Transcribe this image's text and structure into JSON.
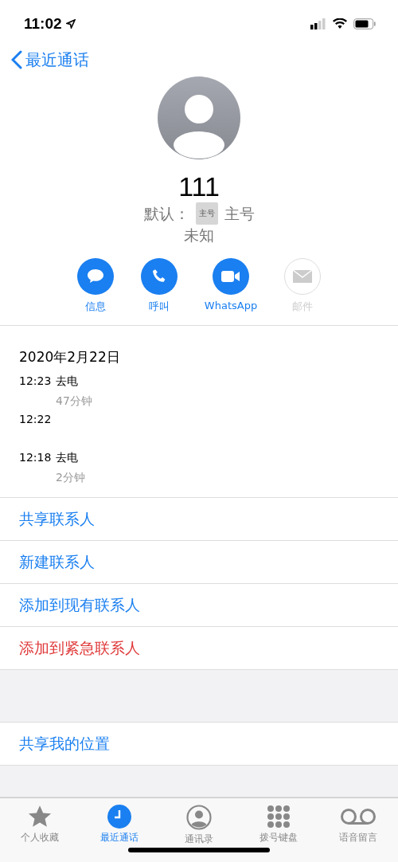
{
  "status_bar": {
    "time": "11:02"
  },
  "nav": {
    "back": "最近通话"
  },
  "contact": {
    "name": "111",
    "default_label": "默认：",
    "number_tag": "主号",
    "number_label": "主号",
    "location": "未知"
  },
  "actions": [
    {
      "kind": "message",
      "label": "信息",
      "disabled": false
    },
    {
      "kind": "call",
      "label": "呼叫",
      "disabled": false
    },
    {
      "kind": "video",
      "label": "WhatsApp",
      "disabled": false
    },
    {
      "kind": "mail",
      "label": "邮件",
      "disabled": true
    }
  ],
  "call_history": {
    "date": "2020年2月22日",
    "calls": [
      {
        "time": "12:23",
        "type": "去电",
        "duration": "47分钟"
      },
      {
        "time": "12:22"
      },
      {
        "time": "12:18",
        "type": "去电",
        "duration": "2分钟"
      }
    ]
  },
  "options": [
    {
      "label": "共享联系人",
      "destructive": false
    },
    {
      "label": "新建联系人",
      "destructive": false
    },
    {
      "label": "添加到现有联系人",
      "destructive": false
    },
    {
      "label": "添加到紧急联系人",
      "destructive": true
    }
  ],
  "location_option": {
    "label": "共享我的位置"
  },
  "tab_bar": [
    {
      "kind": "star",
      "label": "个人收藏",
      "selected": false
    },
    {
      "kind": "clock",
      "label": "最近通话",
      "selected": true
    },
    {
      "kind": "person",
      "label": "通讯录",
      "selected": false
    },
    {
      "kind": "keypad",
      "label": "拨号键盘",
      "selected": false
    },
    {
      "kind": "voicemail",
      "label": "语音留言",
      "selected": false
    }
  ]
}
